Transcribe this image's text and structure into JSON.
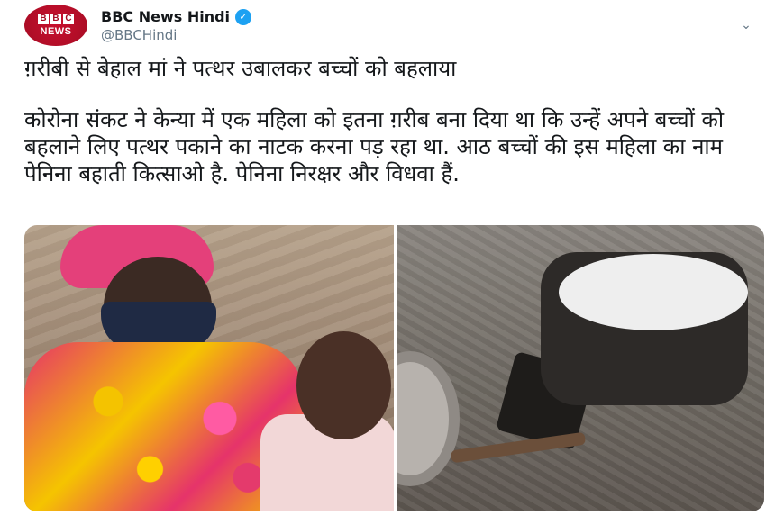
{
  "account": {
    "display_name": "BBC News Hindi",
    "handle": "@BBCHindi",
    "avatar_logo_letters": [
      "B",
      "B",
      "C"
    ],
    "avatar_logo_word": "NEWS",
    "verified_icon": "verified-badge-icon",
    "menu_icon": "chevron-down-icon"
  },
  "tweet": {
    "headline": "ग़रीबी से बेहाल मां ने पत्थर उबालकर बच्चों को बहलाया",
    "body": "कोरोना संकट ने केन्या में एक महिला को इतना ग़रीब बना दिया था कि उन्हें अपने बच्चों को बहलाने लिए पत्थर पकाने का नाटक करना पड़ रहा था. आठ बच्चों की इस महिला का नाम पेनिना बहाती कित्साओ है. पेनिना निरक्षर और विधवा हैं."
  },
  "colors": {
    "text": "#14171a",
    "secondary_text": "#657786",
    "verified": "#1da1f2",
    "bbc_red": "#c8102e"
  }
}
